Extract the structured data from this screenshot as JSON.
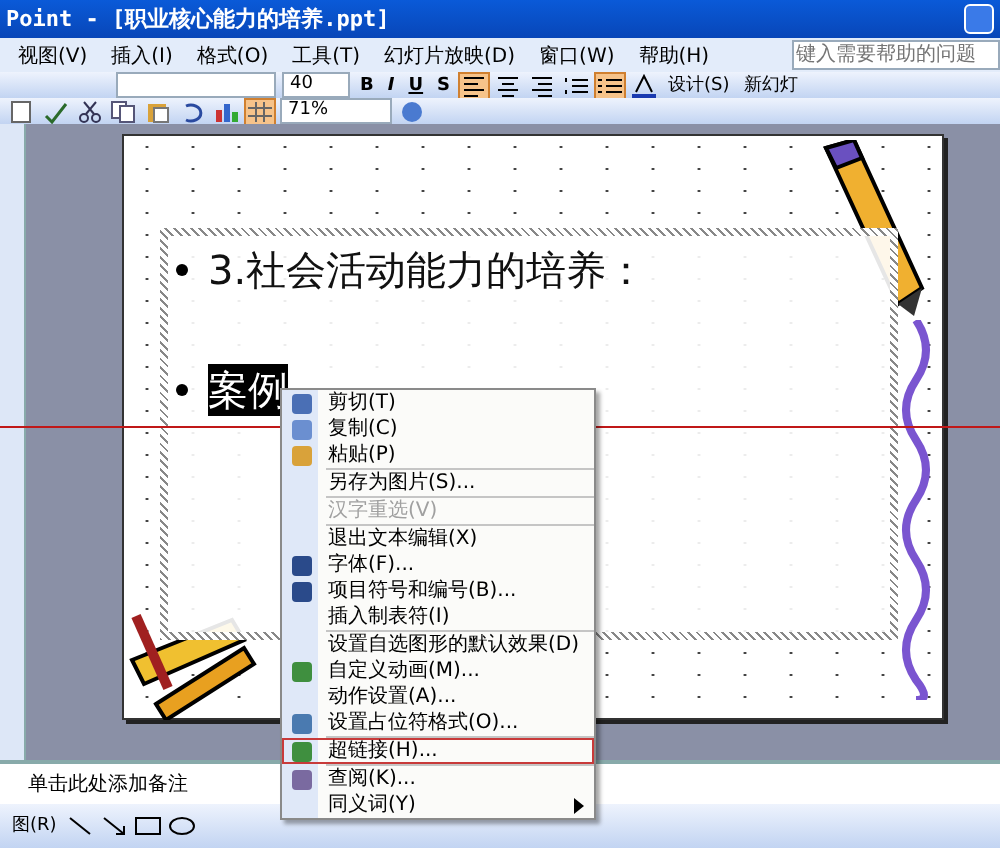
{
  "window": {
    "title": "Point - [职业核心能力的培养.ppt]"
  },
  "menu_bar": [
    "视图(V)",
    "插入(I)",
    "格式(O)",
    "工具(T)",
    "幻灯片放映(D)",
    "窗口(W)",
    "帮助(H)"
  ],
  "help_box": {
    "placeholder": "键入需要帮助的问题"
  },
  "formatting_toolbar": {
    "font_size": "40",
    "style_buttons": [
      "B",
      "I",
      "U",
      "S"
    ],
    "design_button": "设计(S)",
    "new_slide_button": "新幻灯"
  },
  "standard_toolbar": {
    "zoom": "71%"
  },
  "slide": {
    "title": "3.社会活动能力的培养：",
    "bullet": "案例",
    "bullet_selected": true
  },
  "context_menu": {
    "items": [
      {
        "kind": "item",
        "label": "剪切(T)",
        "disabled": false,
        "selected": false,
        "submenu": false
      },
      {
        "kind": "item",
        "label": "复制(C)",
        "disabled": false,
        "selected": false,
        "submenu": false
      },
      {
        "kind": "item",
        "label": "粘贴(P)",
        "disabled": false,
        "selected": false,
        "submenu": false
      },
      {
        "kind": "separator"
      },
      {
        "kind": "item",
        "label": "另存为图片(S)...",
        "disabled": false,
        "selected": false,
        "submenu": false
      },
      {
        "kind": "separator"
      },
      {
        "kind": "item",
        "label": "汉字重选(V)",
        "disabled": true,
        "selected": false,
        "submenu": false
      },
      {
        "kind": "separator"
      },
      {
        "kind": "item",
        "label": "退出文本编辑(X)",
        "disabled": false,
        "selected": false,
        "submenu": false
      },
      {
        "kind": "item",
        "label": "字体(F)...",
        "disabled": false,
        "selected": false,
        "submenu": false
      },
      {
        "kind": "item",
        "label": "项目符号和编号(B)...",
        "disabled": false,
        "selected": false,
        "submenu": false
      },
      {
        "kind": "item",
        "label": "插入制表符(I)",
        "disabled": false,
        "selected": false,
        "submenu": false
      },
      {
        "kind": "separator"
      },
      {
        "kind": "item",
        "label": "设置自选图形的默认效果(D)",
        "disabled": false,
        "selected": false,
        "submenu": false
      },
      {
        "kind": "item",
        "label": "自定义动画(M)...",
        "disabled": false,
        "selected": false,
        "submenu": false
      },
      {
        "kind": "item",
        "label": "动作设置(A)...",
        "disabled": false,
        "selected": false,
        "submenu": false
      },
      {
        "kind": "item",
        "label": "设置占位符格式(O)...",
        "disabled": false,
        "selected": false,
        "submenu": false
      },
      {
        "kind": "separator"
      },
      {
        "kind": "item",
        "label": "超链接(H)...",
        "disabled": false,
        "selected": true,
        "submenu": false
      },
      {
        "kind": "separator"
      },
      {
        "kind": "item",
        "label": "查阅(K)...",
        "disabled": false,
        "selected": false,
        "submenu": false
      },
      {
        "kind": "item",
        "label": "同义词(Y)",
        "disabled": false,
        "selected": false,
        "submenu": true
      }
    ]
  },
  "notes": {
    "placeholder": "单击此处添加备注"
  },
  "drawing_toolbar": {
    "menu_label": "图(R)"
  }
}
